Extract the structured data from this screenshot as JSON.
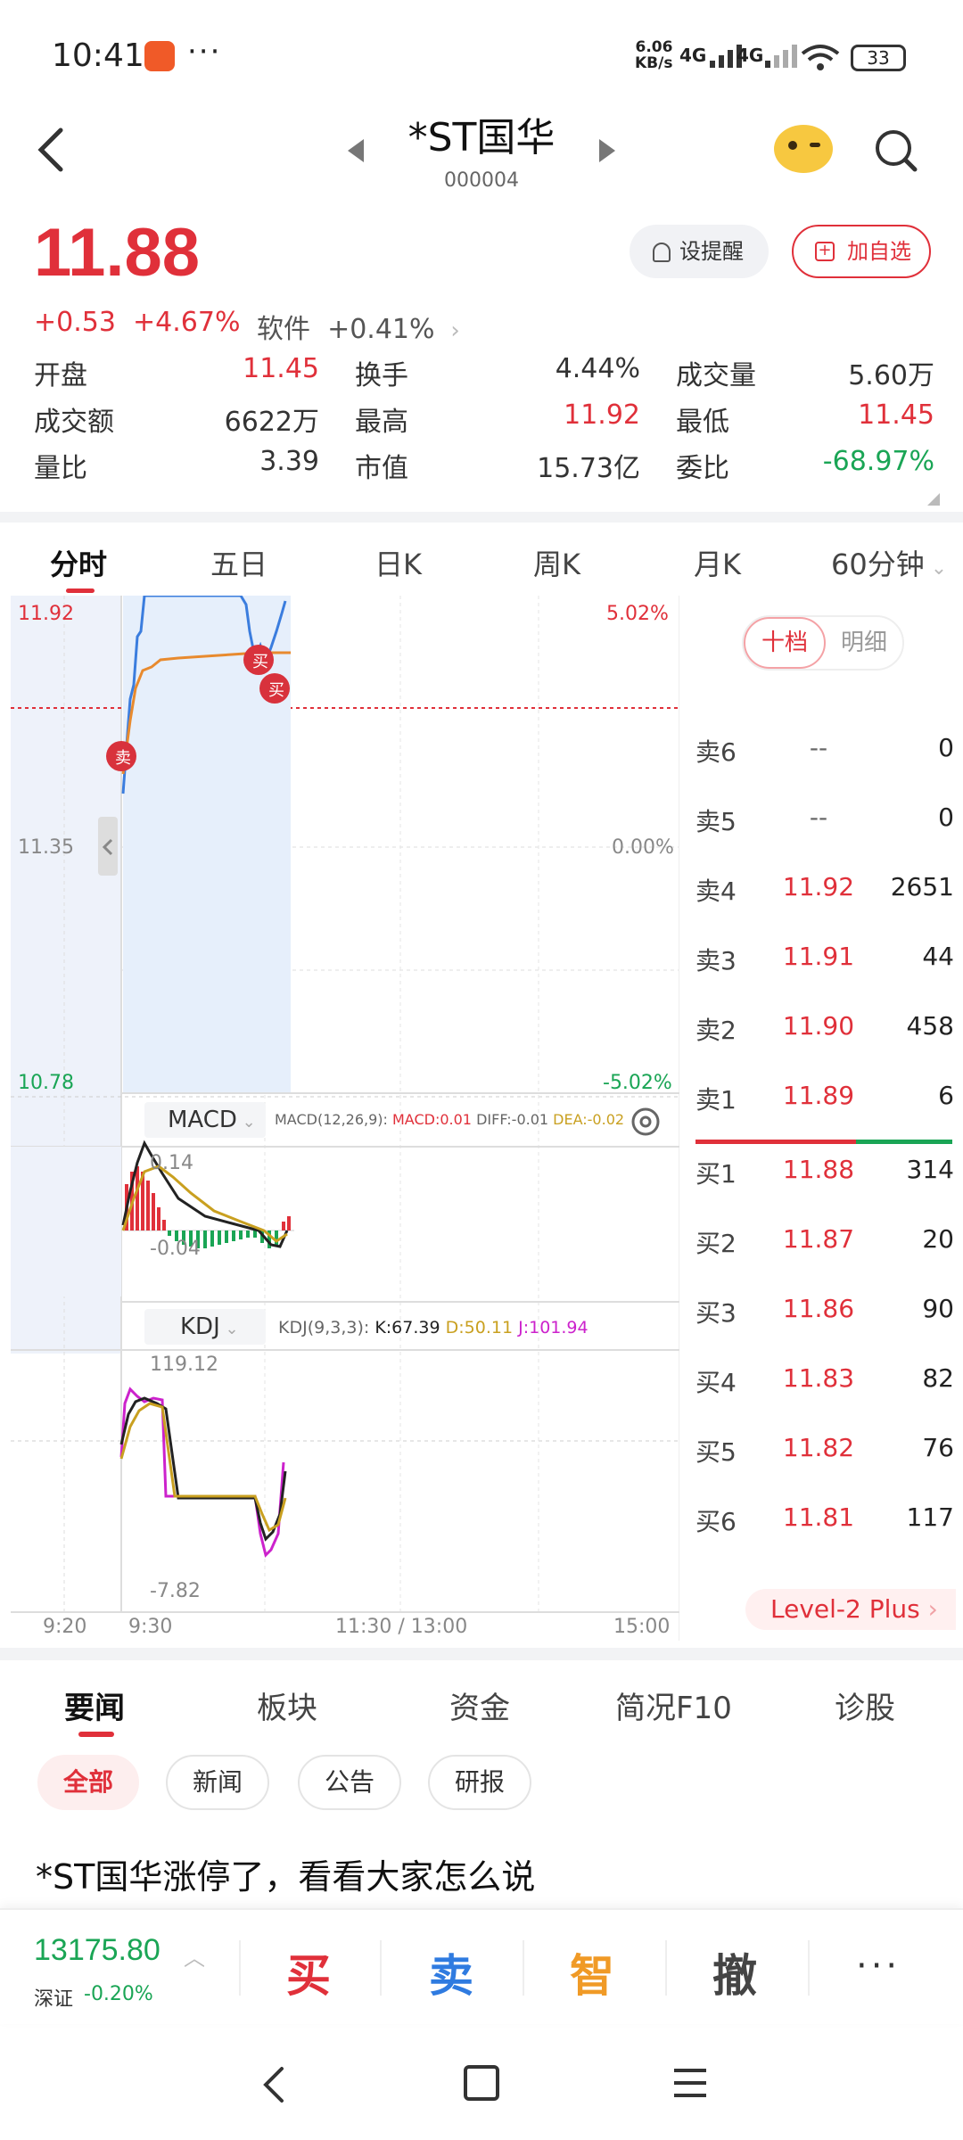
{
  "status_bar": {
    "time": "10:41",
    "net_speed_value": "6.06",
    "net_speed_unit": "KB/s",
    "signal1": "4G",
    "signal2": "4G",
    "battery": "33"
  },
  "header": {
    "title": "*ST国华",
    "code": "000004"
  },
  "quote": {
    "price": "11.88",
    "change": "+0.53",
    "change_pct": "+4.67%",
    "sector_name": "软件",
    "sector_pct": "+0.41%",
    "alert_label": "设提醒",
    "add_label": "加自选",
    "stats": [
      {
        "label": "开盘",
        "value": "11.45",
        "color": "#e0303a"
      },
      {
        "label": "换手",
        "value": "4.44%",
        "color": "#333333"
      },
      {
        "label": "成交量",
        "value": "5.60万",
        "color": "#333333"
      },
      {
        "label": "成交额",
        "value": "6622万",
        "color": "#333333"
      },
      {
        "label": "最高",
        "value": "11.92",
        "color": "#e0303a"
      },
      {
        "label": "最低",
        "value": "11.45",
        "color": "#e0303a"
      },
      {
        "label": "量比",
        "value": "3.39",
        "color": "#333333"
      },
      {
        "label": "市值",
        "value": "15.73亿",
        "color": "#333333"
      },
      {
        "label": "委比",
        "value": "-68.97%",
        "color": "#1aa555"
      }
    ]
  },
  "period_tabs": [
    "分时",
    "五日",
    "日K",
    "周K",
    "月K",
    "60分钟"
  ],
  "chart": {
    "price_high": "11.92",
    "price_mid": "11.35",
    "price_low": "10.78",
    "pct_high": "5.02%",
    "pct_mid": "0.00%",
    "pct_low": "-5.02%",
    "trade_buy": "买",
    "trade_sell": "卖",
    "macd_label": "MACD",
    "macd_params": "MACD(12,26,9):",
    "macd_val": "MACD:0.01",
    "diff_val": "DIFF:-0.01",
    "dea_val": "DEA:-0.02",
    "macd_top": "0.14",
    "macd_bottom": "-0.04",
    "kdj_label": "KDJ",
    "kdj_params": "KDJ(9,3,3):",
    "k_val": "K:67.39",
    "d_val": "D:50.11",
    "j_val": "J:101.94",
    "kdj_top": "119.12",
    "kdj_bottom": "-7.82",
    "time_0": "9:20",
    "time_1": "9:30",
    "time_2": "11:30 / 13:00",
    "time_3": "15:00"
  },
  "order_book": {
    "tab_a": "十档",
    "tab_b": "明细",
    "asks": [
      {
        "label": "卖6",
        "price": "--",
        "vol": "0"
      },
      {
        "label": "卖5",
        "price": "--",
        "vol": "0"
      },
      {
        "label": "卖4",
        "price": "11.92",
        "vol": "2651"
      },
      {
        "label": "卖3",
        "price": "11.91",
        "vol": "44"
      },
      {
        "label": "卖2",
        "price": "11.90",
        "vol": "458"
      },
      {
        "label": "卖1",
        "price": "11.89",
        "vol": "6"
      }
    ],
    "bids": [
      {
        "label": "买1",
        "price": "11.88",
        "vol": "314"
      },
      {
        "label": "买2",
        "price": "11.87",
        "vol": "20"
      },
      {
        "label": "买3",
        "price": "11.86",
        "vol": "90"
      },
      {
        "label": "买4",
        "price": "11.83",
        "vol": "82"
      },
      {
        "label": "买5",
        "price": "11.82",
        "vol": "76"
      },
      {
        "label": "买6",
        "price": "11.81",
        "vol": "117"
      }
    ],
    "level2": "Level-2 Plus"
  },
  "news": {
    "tabs": [
      "要闻",
      "板块",
      "资金",
      "简况F10",
      "诊股"
    ],
    "chips": [
      "全部",
      "新闻",
      "公告",
      "研报"
    ],
    "headline": "*ST国华涨停了，看看大家怎么说"
  },
  "bottom_bar": {
    "index_value": "13175.80",
    "index_name": "深证",
    "index_change": "-0.20%",
    "buy": "买",
    "sell": "卖",
    "smart": "智",
    "cancel": "撤",
    "more": "···"
  },
  "colors": {
    "up": "#e0303a",
    "down": "#1aa555",
    "price_line": "#3b7dde",
    "avg_line": "#e88a2e"
  }
}
